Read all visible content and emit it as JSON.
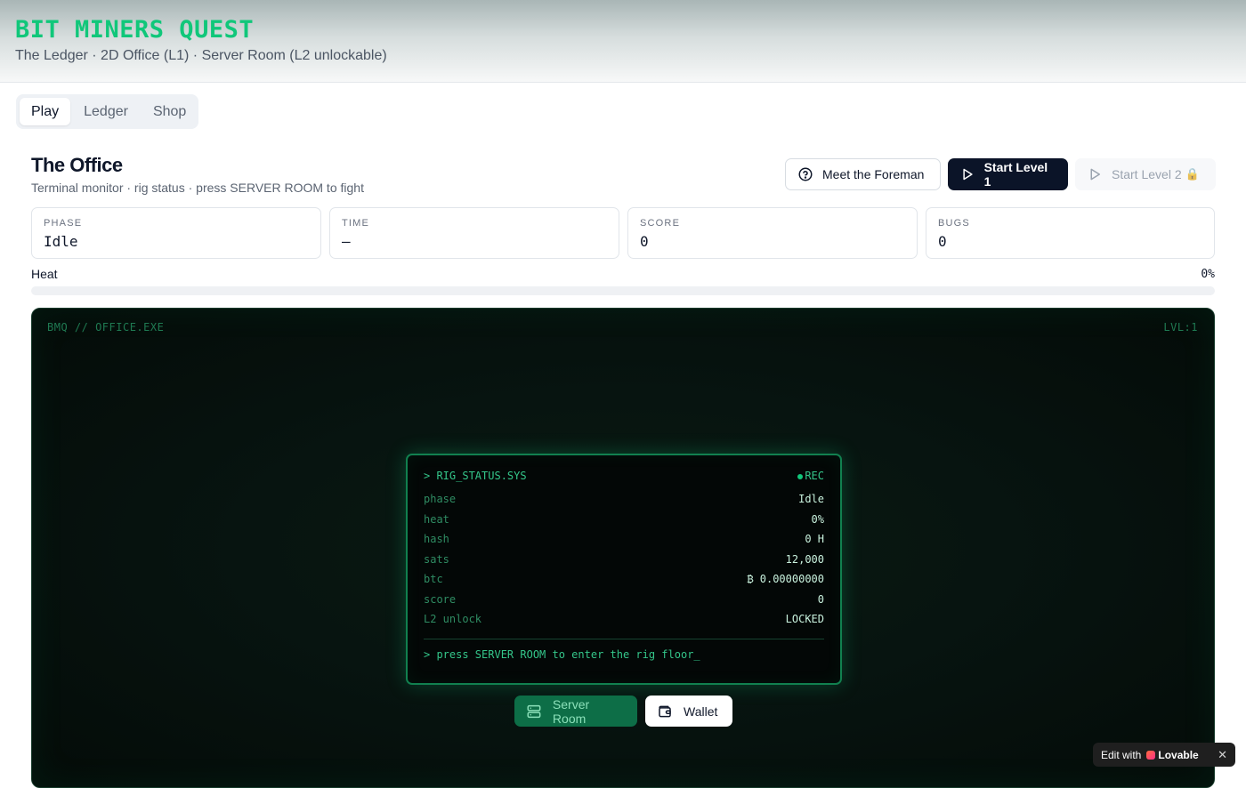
{
  "header": {
    "title": "BIT MINERS QUEST",
    "subtitle": "The Ledger · 2D Office (L1) · Server Room (L2 unlockable)"
  },
  "tabs": [
    {
      "label": "Play",
      "active": true
    },
    {
      "label": "Ledger",
      "active": false
    },
    {
      "label": "Shop",
      "active": false
    }
  ],
  "section": {
    "title": "The Office",
    "subtitle": "Terminal monitor · rig status · press SERVER ROOM to fight"
  },
  "actions": {
    "foreman_label": "Meet the Foreman",
    "start_l1_label": "Start Level 1",
    "start_l2_label": "Start Level 2",
    "start_l2_lock": "🔒"
  },
  "stats": {
    "phase": {
      "label": "PHASE",
      "value": "Idle"
    },
    "time": {
      "label": "TIME",
      "value": "—"
    },
    "score": {
      "label": "SCORE",
      "value": "0"
    },
    "bugs": {
      "label": "BUGS",
      "value": "0"
    }
  },
  "heat": {
    "label": "Heat",
    "percent_text": "0%",
    "percent": 0
  },
  "screen": {
    "top_left": "BMQ // OFFICE.EXE",
    "top_right": "LVL:1",
    "panel": {
      "title": "> RIG_STATUS.SYS",
      "rec": "REC",
      "rows": [
        {
          "k": "phase",
          "v": "Idle"
        },
        {
          "k": "heat",
          "v": "0%"
        },
        {
          "k": "hash",
          "v": "0 H"
        },
        {
          "k": "sats",
          "v": "12,000"
        },
        {
          "k": "btc",
          "v": "₿ 0.00000000"
        },
        {
          "k": "score",
          "v": "0"
        },
        {
          "k": "L2 unlock",
          "v": "LOCKED"
        }
      ],
      "prompt": "> press SERVER ROOM to enter the rig floor_"
    },
    "server_room_label": "Server Room",
    "wallet_label": "Wallet"
  },
  "badge": {
    "edit_with": "Edit with",
    "brand": "Lovable",
    "close": "✕"
  },
  "colors": {
    "accent": "#10c77a",
    "dark_button": "#0b1428",
    "terminal_bg": "#040b08"
  }
}
